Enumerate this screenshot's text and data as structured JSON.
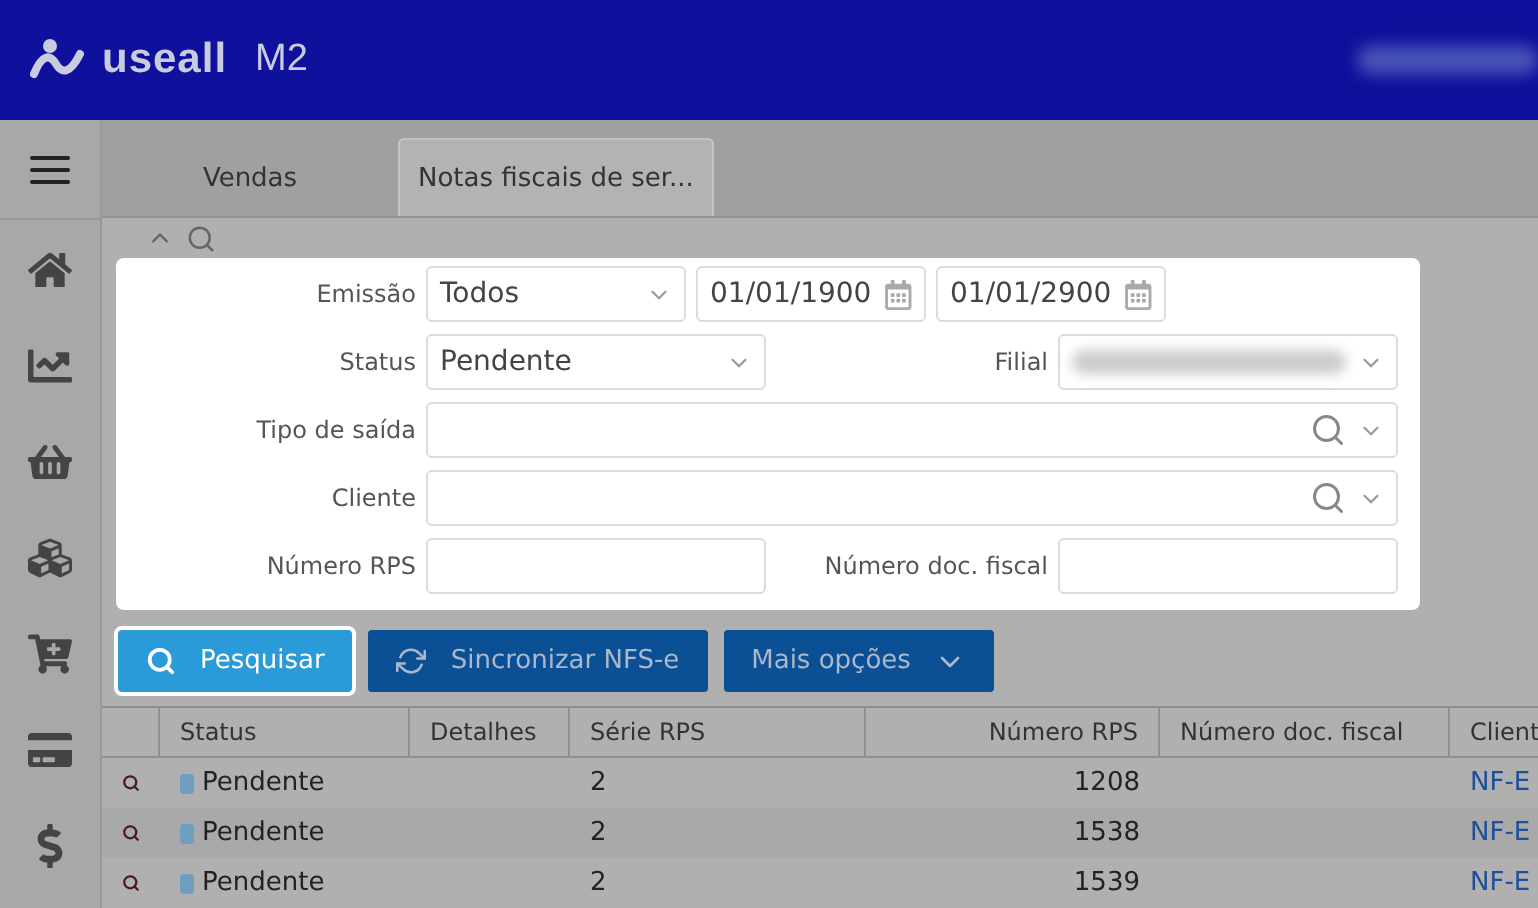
{
  "header": {
    "logo": "useall",
    "product": "M2"
  },
  "tabs": [
    {
      "label": "Vendas",
      "selected": false
    },
    {
      "label": "Notas fiscais de ser...",
      "selected": true
    }
  ],
  "filter_rows": [
    {
      "kind": "range",
      "fields": [
        {
          "label": "Emissão",
          "kind": "select",
          "value": "Todos"
        },
        {
          "kind": "date",
          "value": "01/01/1900"
        },
        {
          "kind": "date",
          "value": "01/01/2900"
        }
      ]
    },
    {
      "kind": "pair",
      "fields": [
        {
          "label": "Status",
          "kind": "select",
          "value": "Pendente"
        },
        {
          "label": "Filial",
          "kind": "blurred-select"
        }
      ]
    },
    {
      "kind": "wide",
      "fields": [
        {
          "label": "Tipo de saída",
          "kind": "lookup"
        }
      ]
    },
    {
      "kind": "wide",
      "fields": [
        {
          "label": "Cliente",
          "kind": "lookup"
        }
      ]
    },
    {
      "kind": "pair",
      "fields": [
        {
          "label": "Número RPS",
          "kind": "text"
        },
        {
          "label": "Número doc. fiscal",
          "kind": "text"
        }
      ]
    }
  ],
  "buttons": [
    {
      "label": "Pesquisar",
      "kind": "search",
      "highlighted": true
    },
    {
      "label": "Sincronizar NFS-e",
      "kind": "sync",
      "highlighted": false
    },
    {
      "label": "Mais opções",
      "kind": "menu",
      "highlighted": false
    }
  ],
  "table": {
    "columns": [
      "Status",
      "Detalhes",
      "Série RPS",
      "Número RPS",
      "Número doc. fiscal",
      "Client"
    ],
    "rows": [
      {
        "color": "#6e9fbf",
        "cells": [
          "Pendente",
          "",
          "2",
          "1208",
          "",
          "NF-E"
        ]
      },
      {
        "color": "#6e9fbf",
        "cells": [
          "Pendente",
          "",
          "2",
          "1538",
          "",
          "NF-E"
        ]
      },
      {
        "color": "#6e9fbf",
        "cells": [
          "Pendente",
          "",
          "2",
          "1539",
          "",
          "NF-E"
        ]
      }
    ]
  }
}
